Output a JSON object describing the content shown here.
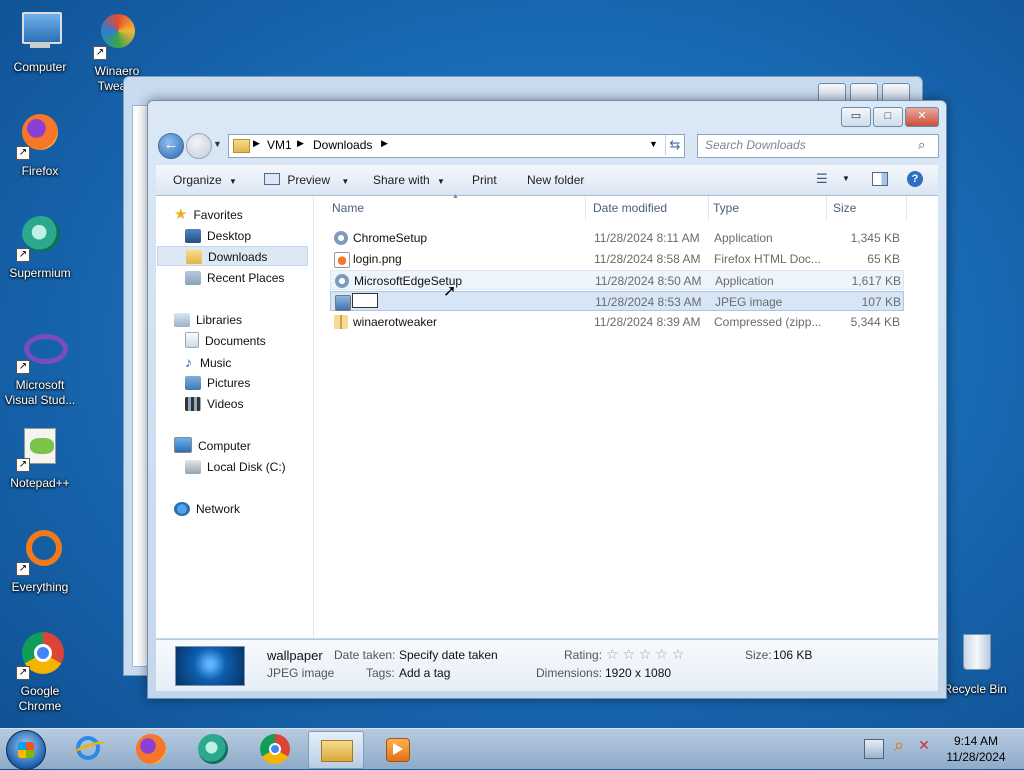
{
  "desktop": {
    "icons": [
      {
        "label": "Computer"
      },
      {
        "label": "Winaero Twea..."
      },
      {
        "label": "Firefox"
      },
      {
        "label": "Supermium"
      },
      {
        "label": "Microsoft Visual Stud..."
      },
      {
        "label": "Notepad++"
      },
      {
        "label": "Everything"
      },
      {
        "label": "Google Chrome"
      },
      {
        "label": "Recycle Bin"
      }
    ]
  },
  "window": {
    "controls": {
      "minimize": "▭",
      "maximize": "□",
      "close": "✕"
    },
    "breadcrumb": [
      "VM1",
      "Downloads"
    ],
    "search_placeholder": "Search Downloads",
    "toolbar": {
      "organize": "Organize",
      "preview": "Preview",
      "share_with": "Share with",
      "print": "Print",
      "new_folder": "New folder"
    },
    "nav": {
      "favorites": "Favorites",
      "desktop": "Desktop",
      "downloads": "Downloads",
      "recent_places": "Recent Places",
      "libraries": "Libraries",
      "documents": "Documents",
      "music": "Music",
      "pictures": "Pictures",
      "videos": "Videos",
      "computer": "Computer",
      "local_disk": "Local Disk (C:)",
      "network": "Network"
    },
    "columns": {
      "name": "Name",
      "date": "Date modified",
      "type": "Type",
      "size": "Size"
    },
    "files": [
      {
        "name": "ChromeSetup",
        "date": "11/28/2024 8:11 AM",
        "type": "Application",
        "size": "1,345 KB"
      },
      {
        "name": "login.png",
        "date": "11/28/2024 8:58 AM",
        "type": "Firefox HTML Doc...",
        "size": "65 KB"
      },
      {
        "name": "MicrosoftEdgeSetup",
        "date": "11/28/2024 8:50 AM",
        "type": "Application",
        "size": "1,617 KB"
      },
      {
        "name": "",
        "date": "11/28/2024 8:53 AM",
        "type": "JPEG image",
        "size": "107 KB"
      },
      {
        "name": "winaerotweaker",
        "date": "11/28/2024 8:39 AM",
        "type": "Compressed (zipp...",
        "size": "5,344 KB"
      }
    ],
    "details": {
      "filename": "wallpaper",
      "filetype": "JPEG image",
      "date_taken_label": "Date taken:",
      "date_taken_value": "Specify date taken",
      "tags_label": "Tags:",
      "tags_value": "Add a tag",
      "rating_label": "Rating:",
      "rating_stars": "☆ ☆ ☆ ☆ ☆",
      "dimensions_label": "Dimensions:",
      "dimensions_value": "1920 x 1080",
      "size_label": "Size:",
      "size_value": "106 KB"
    }
  },
  "taskbar": {
    "time": "9:14 AM",
    "date": "11/28/2024"
  }
}
